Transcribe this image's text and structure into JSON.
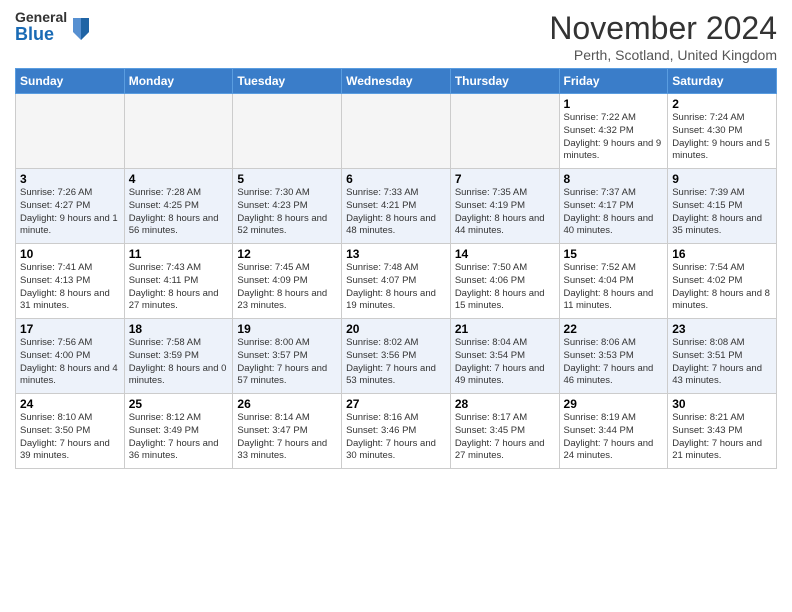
{
  "logo": {
    "general": "General",
    "blue": "Blue"
  },
  "title": "November 2024",
  "location": "Perth, Scotland, United Kingdom",
  "days_of_week": [
    "Sunday",
    "Monday",
    "Tuesday",
    "Wednesday",
    "Thursday",
    "Friday",
    "Saturday"
  ],
  "weeks": [
    [
      {
        "day": "",
        "empty": true
      },
      {
        "day": "",
        "empty": true
      },
      {
        "day": "",
        "empty": true
      },
      {
        "day": "",
        "empty": true
      },
      {
        "day": "",
        "empty": true
      },
      {
        "day": "1",
        "sunrise": "Sunrise: 7:22 AM",
        "sunset": "Sunset: 4:32 PM",
        "daylight": "Daylight: 9 hours and 9 minutes."
      },
      {
        "day": "2",
        "sunrise": "Sunrise: 7:24 AM",
        "sunset": "Sunset: 4:30 PM",
        "daylight": "Daylight: 9 hours and 5 minutes."
      }
    ],
    [
      {
        "day": "3",
        "sunrise": "Sunrise: 7:26 AM",
        "sunset": "Sunset: 4:27 PM",
        "daylight": "Daylight: 9 hours and 1 minute."
      },
      {
        "day": "4",
        "sunrise": "Sunrise: 7:28 AM",
        "sunset": "Sunset: 4:25 PM",
        "daylight": "Daylight: 8 hours and 56 minutes."
      },
      {
        "day": "5",
        "sunrise": "Sunrise: 7:30 AM",
        "sunset": "Sunset: 4:23 PM",
        "daylight": "Daylight: 8 hours and 52 minutes."
      },
      {
        "day": "6",
        "sunrise": "Sunrise: 7:33 AM",
        "sunset": "Sunset: 4:21 PM",
        "daylight": "Daylight: 8 hours and 48 minutes."
      },
      {
        "day": "7",
        "sunrise": "Sunrise: 7:35 AM",
        "sunset": "Sunset: 4:19 PM",
        "daylight": "Daylight: 8 hours and 44 minutes."
      },
      {
        "day": "8",
        "sunrise": "Sunrise: 7:37 AM",
        "sunset": "Sunset: 4:17 PM",
        "daylight": "Daylight: 8 hours and 40 minutes."
      },
      {
        "day": "9",
        "sunrise": "Sunrise: 7:39 AM",
        "sunset": "Sunset: 4:15 PM",
        "daylight": "Daylight: 8 hours and 35 minutes."
      }
    ],
    [
      {
        "day": "10",
        "sunrise": "Sunrise: 7:41 AM",
        "sunset": "Sunset: 4:13 PM",
        "daylight": "Daylight: 8 hours and 31 minutes."
      },
      {
        "day": "11",
        "sunrise": "Sunrise: 7:43 AM",
        "sunset": "Sunset: 4:11 PM",
        "daylight": "Daylight: 8 hours and 27 minutes."
      },
      {
        "day": "12",
        "sunrise": "Sunrise: 7:45 AM",
        "sunset": "Sunset: 4:09 PM",
        "daylight": "Daylight: 8 hours and 23 minutes."
      },
      {
        "day": "13",
        "sunrise": "Sunrise: 7:48 AM",
        "sunset": "Sunset: 4:07 PM",
        "daylight": "Daylight: 8 hours and 19 minutes."
      },
      {
        "day": "14",
        "sunrise": "Sunrise: 7:50 AM",
        "sunset": "Sunset: 4:06 PM",
        "daylight": "Daylight: 8 hours and 15 minutes."
      },
      {
        "day": "15",
        "sunrise": "Sunrise: 7:52 AM",
        "sunset": "Sunset: 4:04 PM",
        "daylight": "Daylight: 8 hours and 11 minutes."
      },
      {
        "day": "16",
        "sunrise": "Sunrise: 7:54 AM",
        "sunset": "Sunset: 4:02 PM",
        "daylight": "Daylight: 8 hours and 8 minutes."
      }
    ],
    [
      {
        "day": "17",
        "sunrise": "Sunrise: 7:56 AM",
        "sunset": "Sunset: 4:00 PM",
        "daylight": "Daylight: 8 hours and 4 minutes."
      },
      {
        "day": "18",
        "sunrise": "Sunrise: 7:58 AM",
        "sunset": "Sunset: 3:59 PM",
        "daylight": "Daylight: 8 hours and 0 minutes."
      },
      {
        "day": "19",
        "sunrise": "Sunrise: 8:00 AM",
        "sunset": "Sunset: 3:57 PM",
        "daylight": "Daylight: 7 hours and 57 minutes."
      },
      {
        "day": "20",
        "sunrise": "Sunrise: 8:02 AM",
        "sunset": "Sunset: 3:56 PM",
        "daylight": "Daylight: 7 hours and 53 minutes."
      },
      {
        "day": "21",
        "sunrise": "Sunrise: 8:04 AM",
        "sunset": "Sunset: 3:54 PM",
        "daylight": "Daylight: 7 hours and 49 minutes."
      },
      {
        "day": "22",
        "sunrise": "Sunrise: 8:06 AM",
        "sunset": "Sunset: 3:53 PM",
        "daylight": "Daylight: 7 hours and 46 minutes."
      },
      {
        "day": "23",
        "sunrise": "Sunrise: 8:08 AM",
        "sunset": "Sunset: 3:51 PM",
        "daylight": "Daylight: 7 hours and 43 minutes."
      }
    ],
    [
      {
        "day": "24",
        "sunrise": "Sunrise: 8:10 AM",
        "sunset": "Sunset: 3:50 PM",
        "daylight": "Daylight: 7 hours and 39 minutes."
      },
      {
        "day": "25",
        "sunrise": "Sunrise: 8:12 AM",
        "sunset": "Sunset: 3:49 PM",
        "daylight": "Daylight: 7 hours and 36 minutes."
      },
      {
        "day": "26",
        "sunrise": "Sunrise: 8:14 AM",
        "sunset": "Sunset: 3:47 PM",
        "daylight": "Daylight: 7 hours and 33 minutes."
      },
      {
        "day": "27",
        "sunrise": "Sunrise: 8:16 AM",
        "sunset": "Sunset: 3:46 PM",
        "daylight": "Daylight: 7 hours and 30 minutes."
      },
      {
        "day": "28",
        "sunrise": "Sunrise: 8:17 AM",
        "sunset": "Sunset: 3:45 PM",
        "daylight": "Daylight: 7 hours and 27 minutes."
      },
      {
        "day": "29",
        "sunrise": "Sunrise: 8:19 AM",
        "sunset": "Sunset: 3:44 PM",
        "daylight": "Daylight: 7 hours and 24 minutes."
      },
      {
        "day": "30",
        "sunrise": "Sunrise: 8:21 AM",
        "sunset": "Sunset: 3:43 PM",
        "daylight": "Daylight: 7 hours and 21 minutes."
      }
    ]
  ]
}
